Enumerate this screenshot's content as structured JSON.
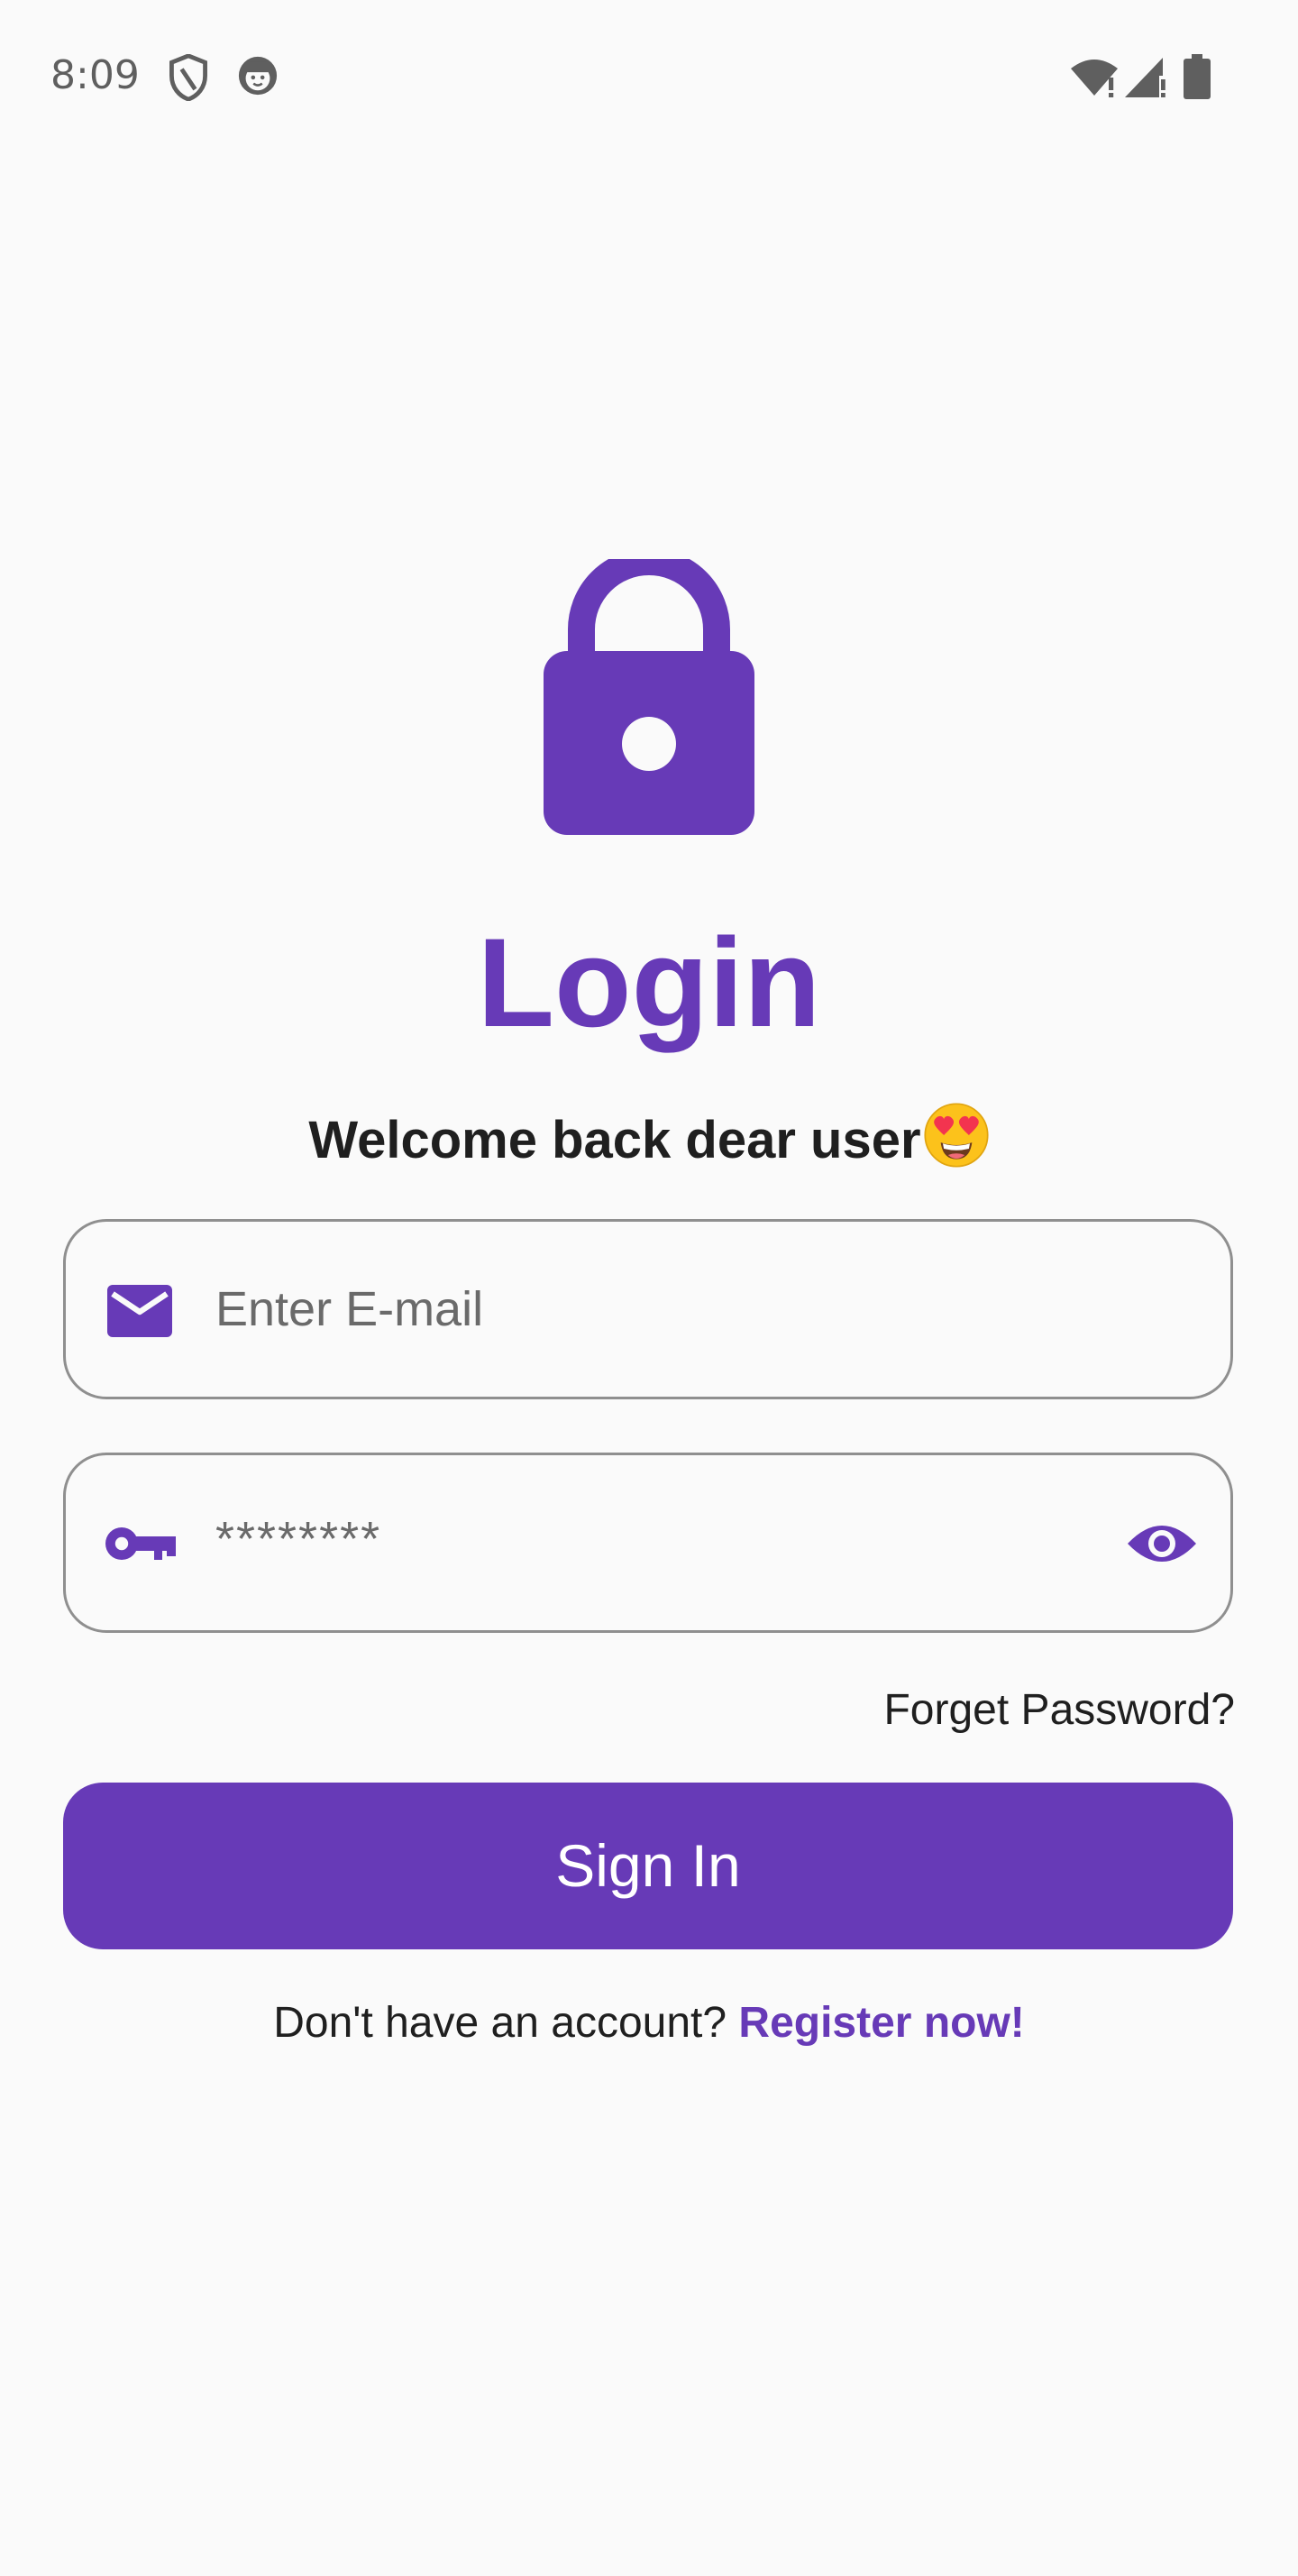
{
  "status_bar": {
    "time": "8:09",
    "icons": [
      "shield-icon",
      "face-icon",
      "wifi-icon",
      "cellular-signal-icon",
      "battery-icon"
    ]
  },
  "colors": {
    "accent": "#673ab7",
    "background": "#fafafa",
    "text": "#1f1f1f",
    "field_border": "#8f8f8f",
    "placeholder": "#6a6a6a"
  },
  "login": {
    "icon": "lock-icon",
    "title": "Login",
    "subtitle": "Welcome back dear user",
    "subtitle_emoji": "heart-eyes-emoji-icon"
  },
  "email_field": {
    "icon": "mail-icon",
    "placeholder": "Enter E-mail",
    "value": ""
  },
  "password_field": {
    "icon": "key-icon",
    "value": "********",
    "toggle_icon": "eye-icon"
  },
  "forget_password": {
    "label": "Forget Password?"
  },
  "sign_in": {
    "label": "Sign In"
  },
  "register": {
    "prompt": "Don't have an account? ",
    "link_label": "Register now!"
  }
}
